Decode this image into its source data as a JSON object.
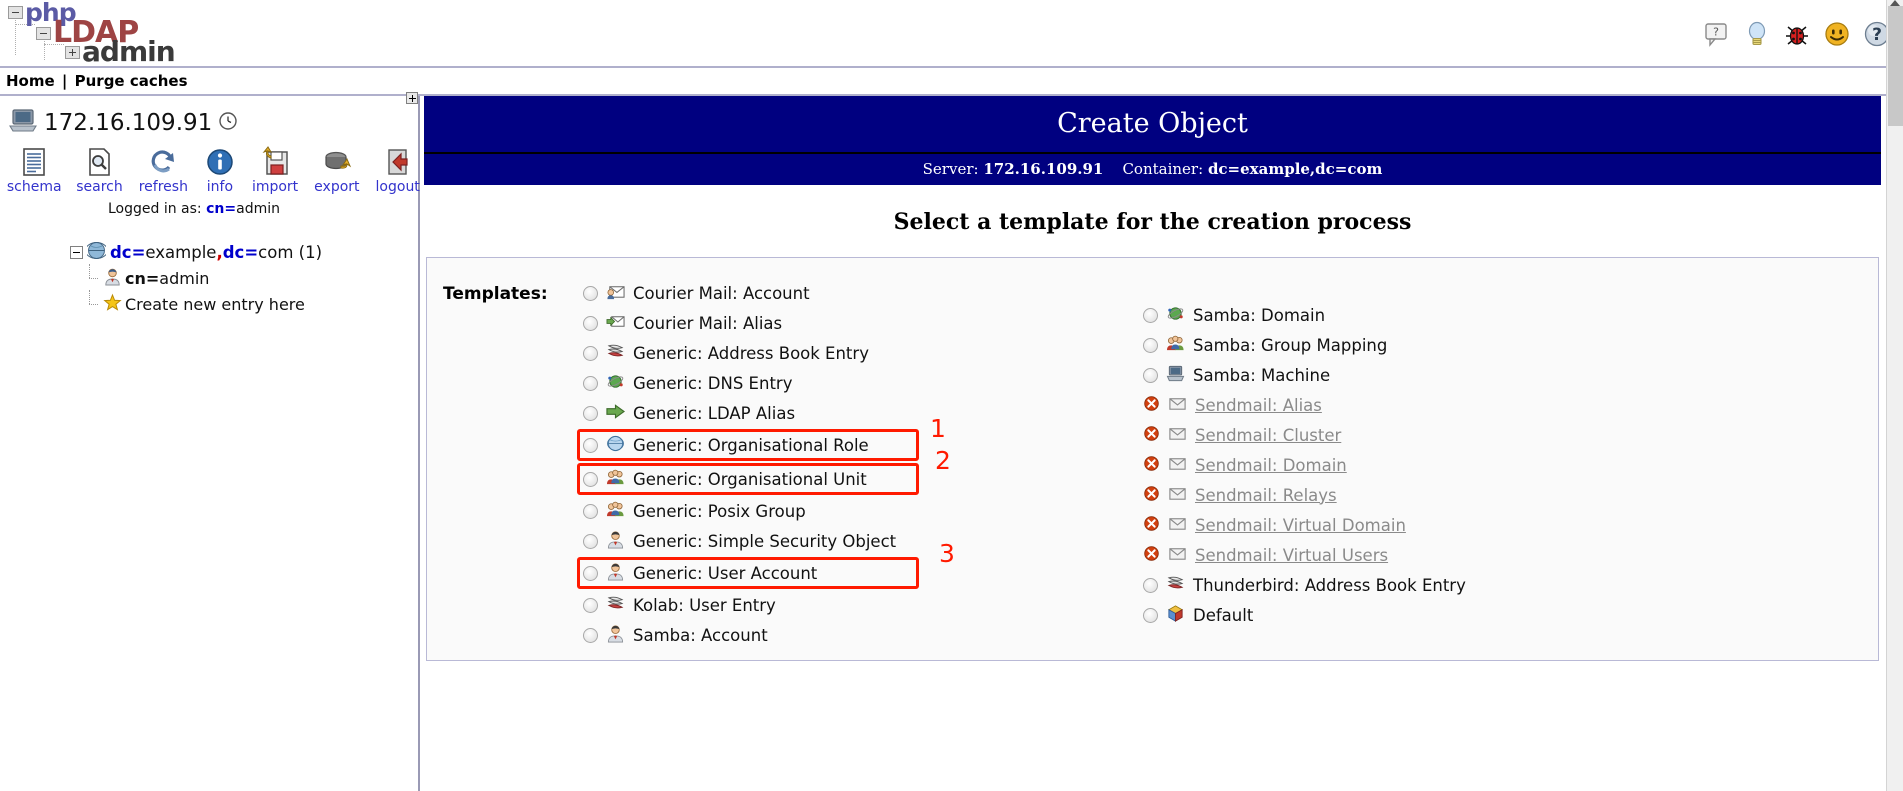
{
  "app": {
    "logo_line1": "php",
    "logo_line2": "LDAP",
    "logo_line3": "admin"
  },
  "header": {
    "icons": [
      {
        "name": "question-bubble-icon",
        "title": "?"
      },
      {
        "name": "lightbulb-icon",
        "title": "hint"
      },
      {
        "name": "bug-icon",
        "title": "report bug"
      },
      {
        "name": "smiley-icon",
        "title": "smile"
      },
      {
        "name": "help-globe-icon",
        "title": "help"
      }
    ]
  },
  "breadcrumb": {
    "home": "Home",
    "separator": "|",
    "purge": "Purge caches"
  },
  "sidebar": {
    "server": "172.16.109.91",
    "clock_icon": "clock-icon",
    "tools": [
      {
        "label": "schema",
        "icon": "schema-icon"
      },
      {
        "label": "search",
        "icon": "search-icon"
      },
      {
        "label": "refresh",
        "icon": "refresh-icon"
      },
      {
        "label": "info",
        "icon": "info-icon"
      },
      {
        "label": "import",
        "icon": "import-icon"
      },
      {
        "label": "export",
        "icon": "export-icon"
      },
      {
        "label": "logout",
        "icon": "logout-icon"
      }
    ],
    "logged_in_prefix": "Logged in as: ",
    "logged_in_key": "cn=",
    "logged_in_value": "admin",
    "tree": {
      "root_key": "dc=",
      "root_v1": "example",
      "root_comma": ",",
      "root_key2": "dc=",
      "root_v2": "com",
      "root_count": "(1)",
      "children": [
        {
          "key": "cn=",
          "value": "admin",
          "icon": "user-icon"
        },
        {
          "label": "Create new entry here",
          "icon": "star-icon"
        }
      ]
    }
  },
  "main": {
    "title": "Create Object",
    "server_label": "Server:",
    "server_value": "172.16.109.91",
    "container_label": "Container:",
    "container_value": "dc=example,dc=com",
    "select_heading": "Select a template for the creation process",
    "templates_label": "Templates:",
    "templates_left": [
      {
        "label": "Courier Mail: Account",
        "icon": "mail-user-icon",
        "disabled": false,
        "highlight": false,
        "annotation": ""
      },
      {
        "label": "Courier Mail: Alias",
        "icon": "mail-arrow-icon",
        "disabled": false,
        "highlight": false,
        "annotation": ""
      },
      {
        "label": "Generic: Address Book Entry",
        "icon": "addressbook-icon",
        "disabled": false,
        "highlight": false,
        "annotation": ""
      },
      {
        "label": "Generic: DNS Entry",
        "icon": "dns-globe-icon",
        "disabled": false,
        "highlight": false,
        "annotation": ""
      },
      {
        "label": "Generic: LDAP Alias",
        "icon": "green-arrow-icon",
        "disabled": false,
        "highlight": false,
        "annotation": ""
      },
      {
        "label": "Generic: Organisational Role",
        "icon": "blue-globe-icon",
        "disabled": false,
        "highlight": true,
        "annotation": "1"
      },
      {
        "label": "Generic: Organisational Unit",
        "icon": "group-icon",
        "disabled": false,
        "highlight": true,
        "annotation": "2"
      },
      {
        "label": "Generic: Posix Group",
        "icon": "group-icon",
        "disabled": false,
        "highlight": false,
        "annotation": ""
      },
      {
        "label": "Generic: Simple Security Object",
        "icon": "user-icon",
        "disabled": false,
        "highlight": false,
        "annotation": ""
      },
      {
        "label": "Generic: User Account",
        "icon": "user-icon",
        "disabled": false,
        "highlight": true,
        "annotation": "3"
      },
      {
        "label": "Kolab: User Entry",
        "icon": "addressbook-icon",
        "disabled": false,
        "highlight": false,
        "annotation": ""
      },
      {
        "label": "Samba: Account",
        "icon": "user-icon",
        "disabled": false,
        "highlight": false,
        "annotation": ""
      }
    ],
    "templates_right": [
      {
        "label": "Samba: Domain",
        "icon": "dns-globe-icon",
        "disabled": false
      },
      {
        "label": "Samba: Group Mapping",
        "icon": "group-icon",
        "disabled": false
      },
      {
        "label": "Samba: Machine",
        "icon": "computer-icon",
        "disabled": false
      },
      {
        "label": "Sendmail: Alias",
        "icon": "envelope-icon",
        "disabled": true
      },
      {
        "label": "Sendmail: Cluster",
        "icon": "envelope-icon",
        "disabled": true
      },
      {
        "label": "Sendmail: Domain",
        "icon": "envelope-icon",
        "disabled": true
      },
      {
        "label": "Sendmail: Relays",
        "icon": "envelope-icon",
        "disabled": true
      },
      {
        "label": "Sendmail: Virtual Domain",
        "icon": "envelope-icon",
        "disabled": true
      },
      {
        "label": "Sendmail: Virtual Users",
        "icon": "envelope-icon",
        "disabled": true
      },
      {
        "label": "Thunderbird: Address Book Entry",
        "icon": "addressbook-icon",
        "disabled": false
      },
      {
        "label": "Default",
        "icon": "cube-icon",
        "disabled": false
      }
    ]
  },
  "colors": {
    "header_navy": "#000080",
    "annotation_red": "#ff1a00",
    "link_blue": "#3333cc",
    "key_blue": "#0000cc",
    "comma_red": "#cc0000"
  }
}
